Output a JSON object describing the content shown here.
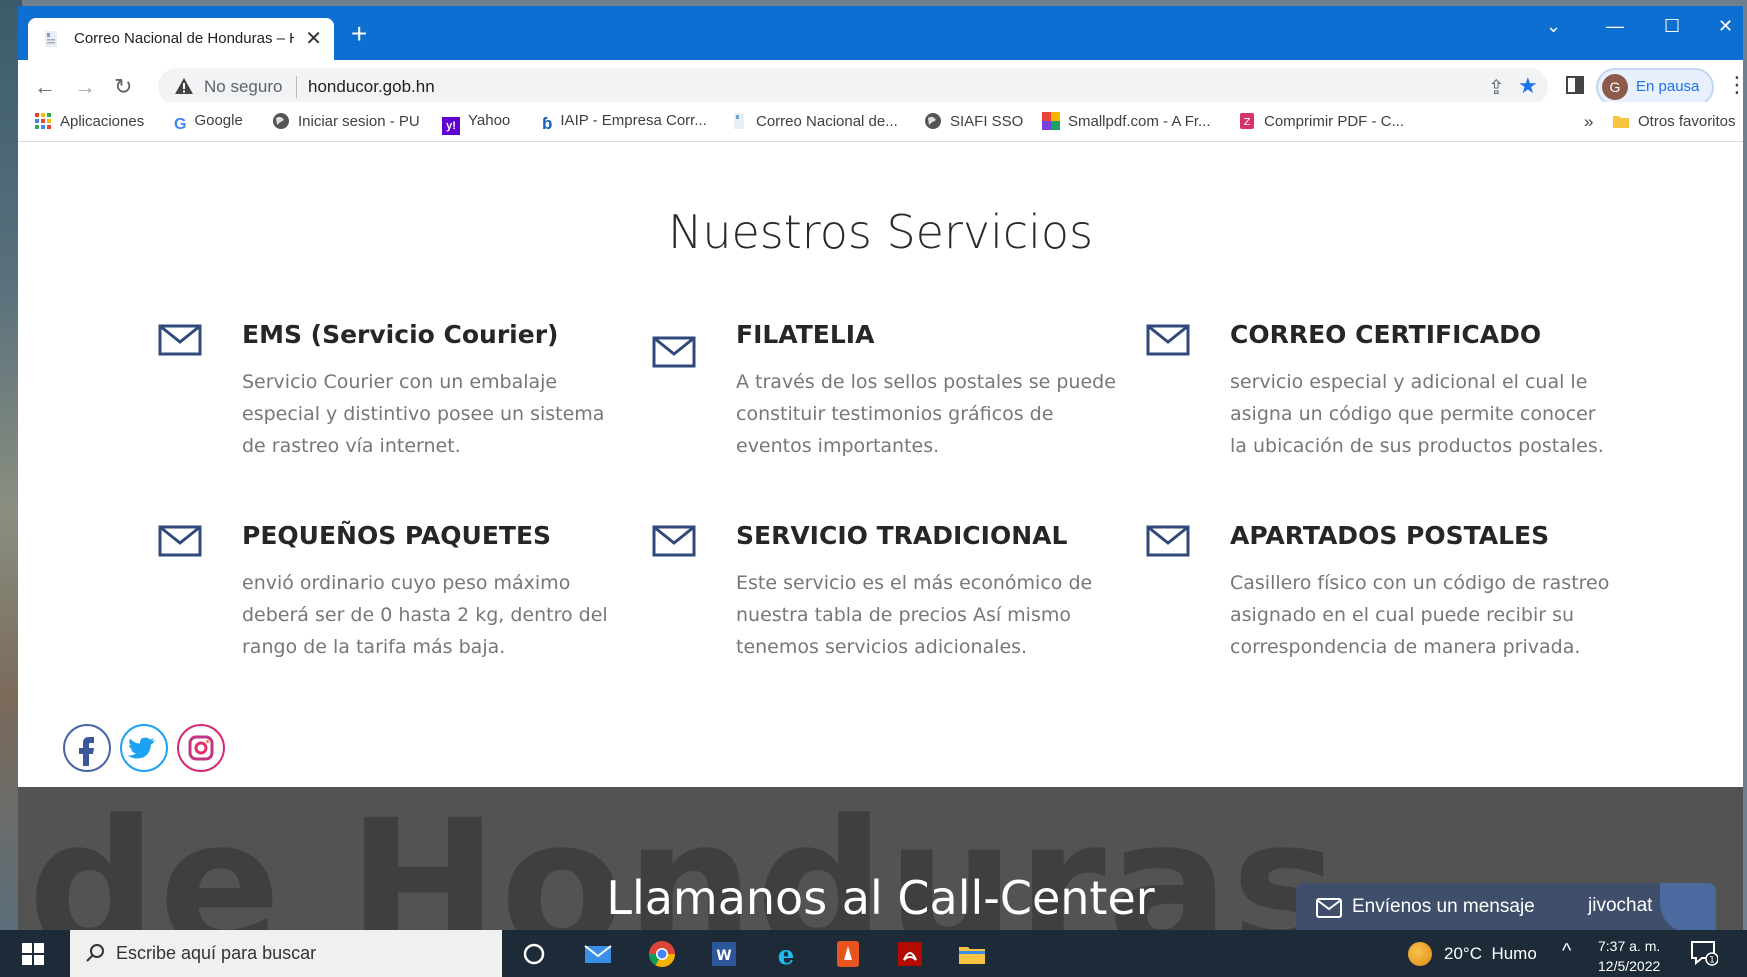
{
  "browser": {
    "tab_title": "Correo Nacional de Honduras – H",
    "new_tab": "+",
    "insecure_label": "No seguro",
    "url": "honducor.gob.hn",
    "profile_initial": "G",
    "profile_status": "En pausa"
  },
  "bookmarks": [
    {
      "label": "Aplicaciones",
      "icon": "apps-grid-icon"
    },
    {
      "label": "Google",
      "icon": "google-icon"
    },
    {
      "label": "Iniciar sesion - PU",
      "icon": "globe-icon"
    },
    {
      "label": "Yahoo",
      "icon": "yahoo-icon"
    },
    {
      "label": "IAIP - Empresa Corr...",
      "icon": "iaip-icon"
    },
    {
      "label": "Correo Nacional de...",
      "icon": "honducor-icon"
    },
    {
      "label": "SIAFI SSO",
      "icon": "globe-icon"
    },
    {
      "label": "Smallpdf.com - A Fr...",
      "icon": "smallpdf-icon"
    },
    {
      "label": "Comprimir PDF - C...",
      "icon": "pdf-compress-icon"
    }
  ],
  "bookmarks_overflow": "»",
  "other_bookmarks": "Otros favoritos",
  "page": {
    "section_title": "Nuestros Servicios",
    "services": [
      {
        "title": "EMS (Servicio Courier)",
        "text": "Servicio Courier con un embalaje especial y distintivo posee un sistema de rastreo vía internet."
      },
      {
        "title": "FILATELIA",
        "text": "A través de los sellos postales se puede constituir testimonios gráficos de eventos importantes."
      },
      {
        "title": "CORREO CERTIFICADO",
        "text": "servicio especial y adicional el cual le asigna un código que permite conocer la ubicación de sus productos postales."
      },
      {
        "title": "PEQUEÑOS PAQUETES",
        "text": "envió ordinario cuyo peso máximo deberá ser de 0 hasta 2 kg, dentro del rango de la tarifa más baja."
      },
      {
        "title": "SERVICIO TRADICIONAL",
        "text": "Este servicio es el más económico de nuestra tabla de precios Así mismo tenemos servicios adicionales."
      },
      {
        "title": "APARTADOS POSTALES",
        "text": "Casillero físico con un código de rastreo asignado en el cual puede recibir su correspondencia de manera privada."
      }
    ],
    "footer_watermark": "de Honduras",
    "footer_cta": "Llamanos al Call-Center",
    "chat_label": "Envíenos un mensaje",
    "chat_brand": "jivochat"
  },
  "taskbar": {
    "search_placeholder": "Escribe aquí para buscar",
    "temperature": "20°C",
    "weather": "Humo",
    "time": "7:37 a. m.",
    "date": "12/5/2022",
    "notification_count": "1"
  },
  "colors": {
    "titlebar": "#0d6fd1",
    "accent": "#1a73e8",
    "footer": "#535353",
    "chat": "#3f4e6b",
    "mail_icon": "#2f4a7a"
  }
}
